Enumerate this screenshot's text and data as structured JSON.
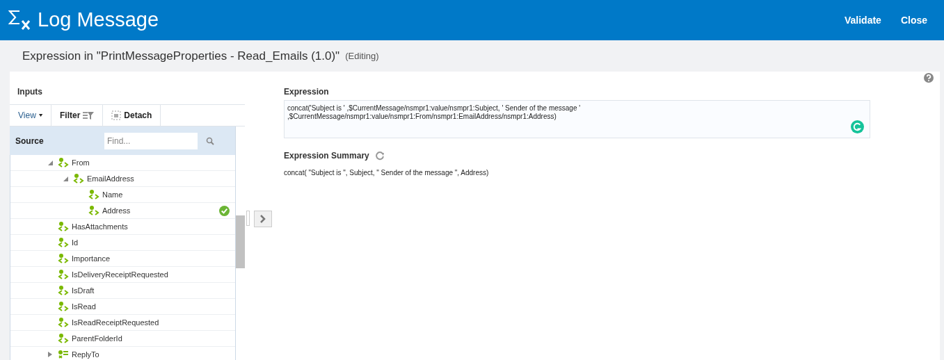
{
  "header": {
    "title": "Log Message",
    "actions": [
      "Validate",
      "Close"
    ]
  },
  "subtitle": {
    "text": "Expression in \"PrintMessageProperties - Read_Emails (1.0)\"",
    "status": "(Editing)"
  },
  "inputs": {
    "title": "Inputs",
    "toolbar": [
      "View",
      "Filter",
      "Detach"
    ],
    "source_label": "Source",
    "search": {
      "placeholder": "Find..."
    },
    "tree": [
      {
        "label": "From",
        "kind": "element",
        "mapped": false,
        "expanded": true,
        "children": [
          {
            "label": "EmailAddress",
            "kind": "element",
            "mapped": false,
            "expanded": true,
            "children": [
              {
                "label": "Name",
                "kind": "element",
                "mapped": false
              },
              {
                "label": "Address",
                "kind": "element",
                "mapped": true
              }
            ]
          }
        ]
      },
      {
        "label": "HasAttachments",
        "kind": "element",
        "mapped": false
      },
      {
        "label": "Id",
        "kind": "element",
        "mapped": false
      },
      {
        "label": "Importance",
        "kind": "element",
        "mapped": false
      },
      {
        "label": "IsDeliveryReceiptRequested",
        "kind": "element",
        "mapped": false
      },
      {
        "label": "IsDraft",
        "kind": "element",
        "mapped": false
      },
      {
        "label": "IsRead",
        "kind": "element",
        "mapped": false
      },
      {
        "label": "IsReadReceiptRequested",
        "kind": "element",
        "mapped": false
      },
      {
        "label": "ParentFolderId",
        "kind": "element",
        "mapped": false
      },
      {
        "label": "ReplyTo",
        "kind": "list",
        "mapped": false,
        "expanded": false
      }
    ]
  },
  "expression": {
    "label": "Expression",
    "value": "concat('Subject is ' ,$CurrentMessage/nsmpr1:value/nsmpr1:Subject, ' Sender of the message '\n,$CurrentMessage/nsmpr1:value/nsmpr1:From/nsmpr1:EmailAddress/nsmpr1:Address)"
  },
  "summary": {
    "label": "Expression Summary",
    "value": "concat( \"Subject is \", Subject, \" Sender of the message \", Address)"
  }
}
